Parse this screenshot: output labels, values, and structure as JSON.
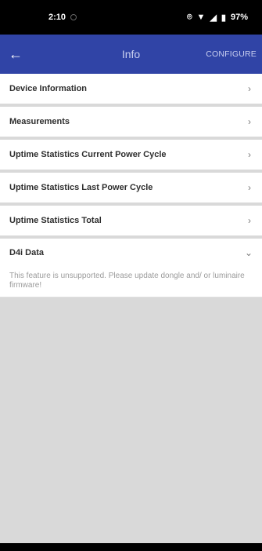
{
  "status_bar": {
    "time": "2:10",
    "icons": {
      "location": "location-icon",
      "wifi": "wifi-icon",
      "signal": "signal-icon",
      "battery": "battery-icon"
    },
    "battery": "97%"
  },
  "app_bar": {
    "title": "Info",
    "configure_label": "CONFIGURE"
  },
  "sections": [
    {
      "label": "Device Information"
    },
    {
      "label": "Measurements"
    },
    {
      "label": "Uptime Statistics Current Power Cycle"
    },
    {
      "label": "Uptime Statistics Last Power Cycle"
    },
    {
      "label": "Uptime Statistics Total"
    }
  ],
  "d4i": {
    "label": "D4i Data",
    "message": "This feature is unsupported. Please update dongle and/ or luminaire firmware!"
  },
  "colors": {
    "app_bar": "#3044a6",
    "background": "#d9d9d9"
  }
}
